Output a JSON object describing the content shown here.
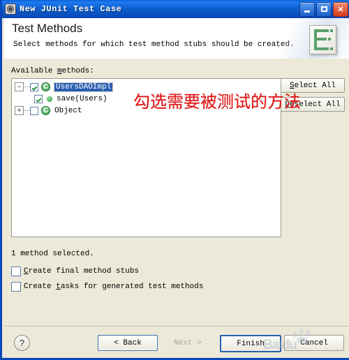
{
  "window": {
    "title": "New JUnit Test Case",
    "icon": "junit-wizard-icon",
    "controls": {
      "minimize": "_",
      "maximize": "□",
      "close": "✕"
    }
  },
  "banner": {
    "title": "Test Methods",
    "subtitle": "Select methods for which test method stubs should be created.",
    "icon": "test-methods-banner-icon"
  },
  "tree_section": {
    "label_prefix": "Available ",
    "label_mnemonic": "m",
    "label_suffix": "ethods:",
    "nodes": [
      {
        "expander": "−",
        "checked": true,
        "icon": "class-icon",
        "label": "UsersDAOImpl",
        "selected": true
      },
      {
        "expander": "",
        "checked": true,
        "icon": "public-method-icon",
        "label": "save(Users)",
        "selected": false
      },
      {
        "expander": "+",
        "checked": false,
        "icon": "class-icon",
        "label": "Object",
        "selected": false
      }
    ],
    "class_icon_letter": "C"
  },
  "side_buttons": {
    "select_all_mnemonic": "S",
    "select_all_rest": "elect All",
    "deselect_all_mnemonic": "D",
    "deselect_all_rest": "eselect All"
  },
  "annotation": {
    "text": "勾选需要被测试的方法",
    "color": "#e01818"
  },
  "status": {
    "text": "1 method selected."
  },
  "options": [
    {
      "checked": false,
      "prefix": "C",
      "mnemonic": "",
      "text_a": "reate final method stubs",
      "full": "Create final method stubs"
    },
    {
      "checked": false,
      "prefix": "Create ",
      "mnemonic": "t",
      "text_a": "asks for generated test methods",
      "full": "Create tasks for generated test methods"
    }
  ],
  "footer": {
    "help": "?",
    "back": "< Back",
    "next": "Next >",
    "finish": "Finish",
    "cancel": "Cancel"
  },
  "watermark": {
    "text": "Baidu",
    "icon": "paw-icon"
  },
  "colors": {
    "titlebar": "#0a5ed0",
    "dialog_bg": "#ECE9D8",
    "selection": "#2a5fb0",
    "annotation_red": "#e01818",
    "icon_green": "#2f8f45"
  }
}
